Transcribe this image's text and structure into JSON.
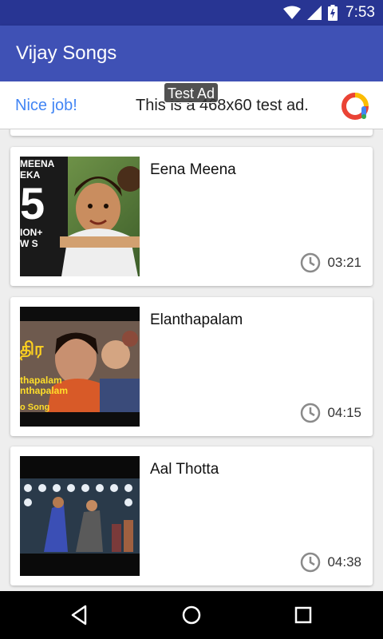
{
  "status_bar": {
    "time": "7:53",
    "icons": [
      "wifi-icon",
      "signal-icon",
      "battery-icon"
    ]
  },
  "app_bar": {
    "title": "Vijay Songs"
  },
  "ad": {
    "cta": "Nice job!",
    "text": "This is a 468x60 test ad.",
    "tag": "Test Ad",
    "icon": "ad-logo-icon"
  },
  "songs": [
    {
      "title": "Eena Meena",
      "duration": "03:21",
      "thumb_text": [
        "MEENA",
        "EKA",
        "5",
        "ION+",
        "W S"
      ]
    },
    {
      "title": "Elanthapalam",
      "duration": "04:15",
      "thumb_text": [
        "திர",
        "thapalam",
        "nthapalam",
        "o Song"
      ]
    },
    {
      "title": "Aal Thotta",
      "duration": "04:38",
      "thumb_text": []
    }
  ],
  "nav": {
    "icons": [
      "back-icon",
      "home-icon",
      "recents-icon"
    ]
  },
  "colors": {
    "status_bar": "#283593",
    "app_bar": "#3f51b5",
    "ad_cta": "#4285f4",
    "background": "#eeeeee"
  }
}
